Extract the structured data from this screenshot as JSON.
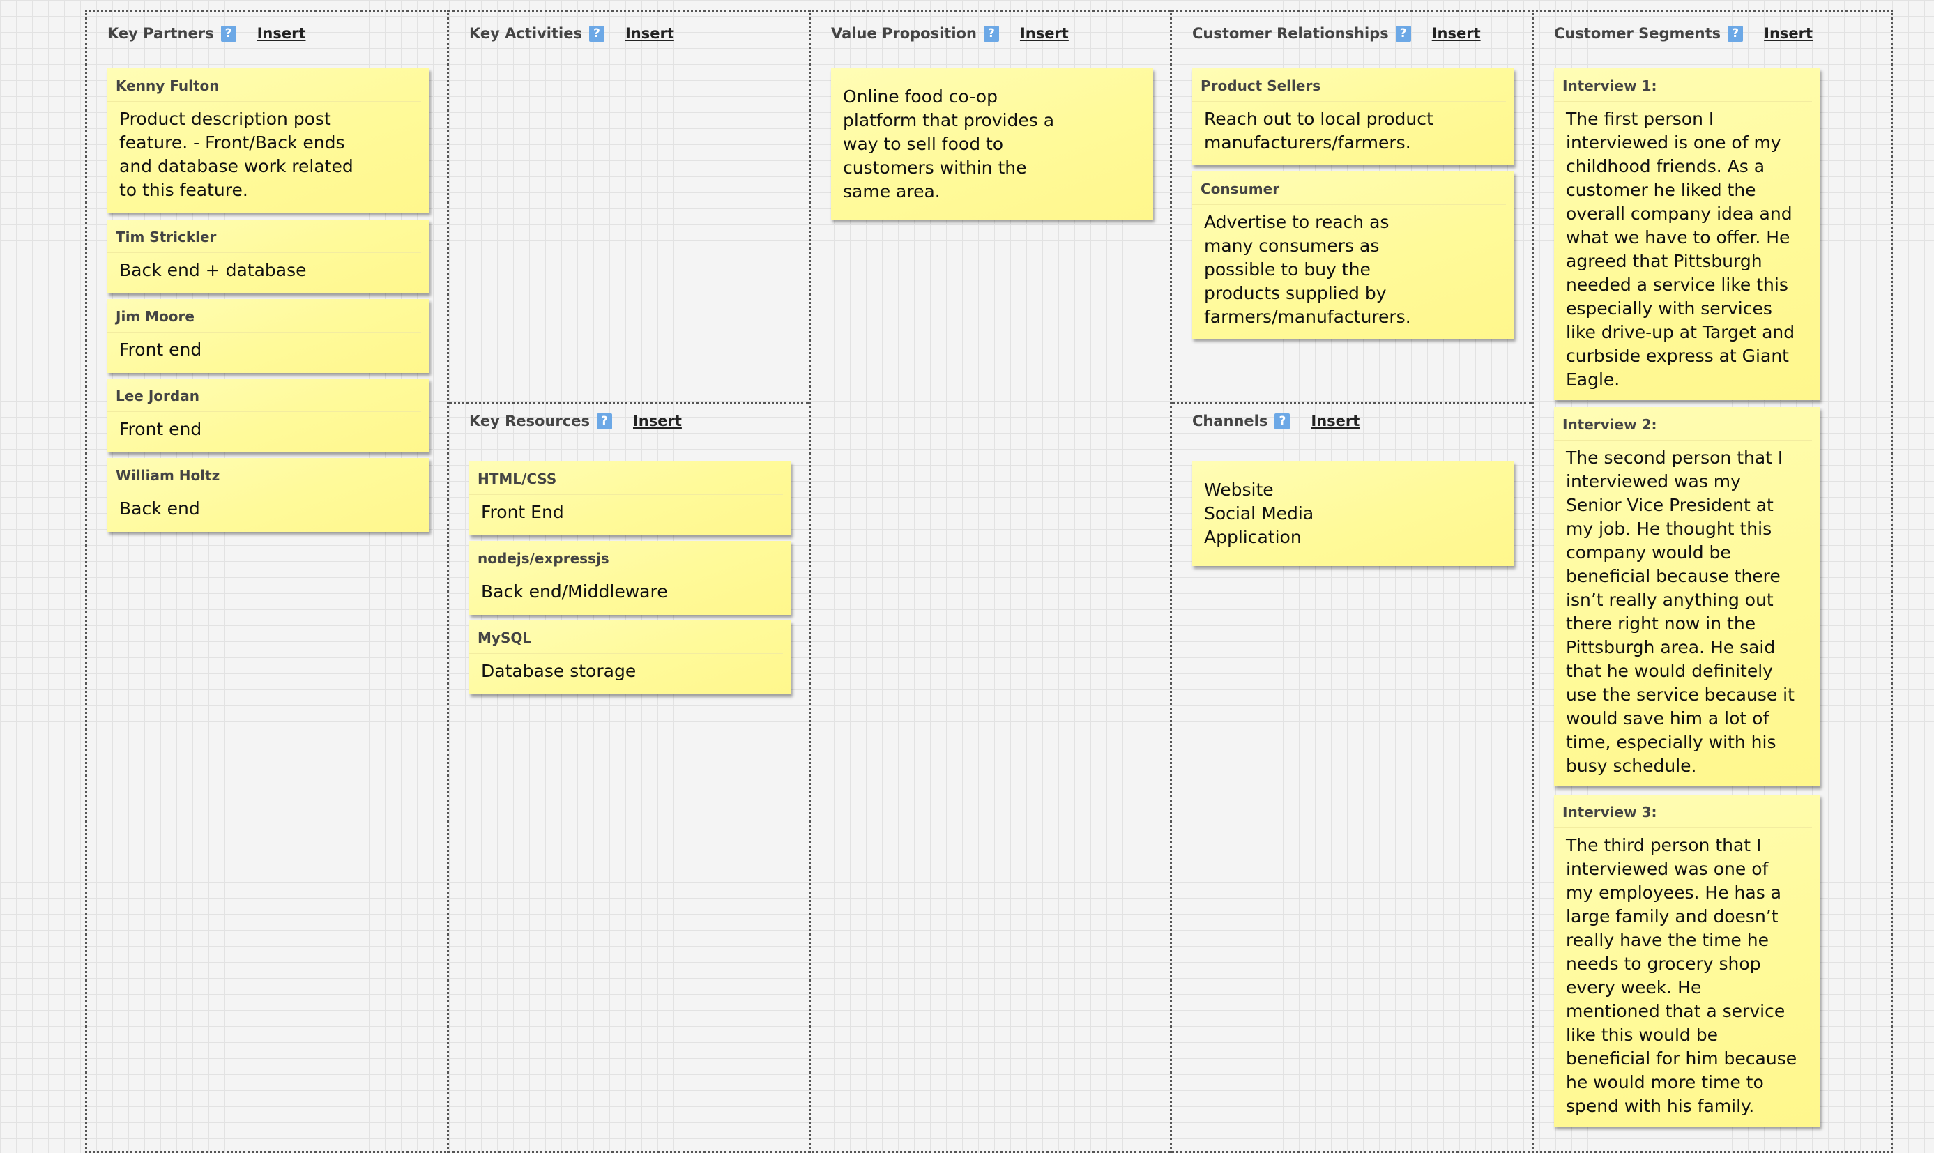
{
  "canvas": {
    "sections": {
      "key_partners": {
        "title": "Key Partners",
        "help": "?",
        "insert": "Insert",
        "notes": [
          {
            "title": "Kenny Fulton",
            "body": "Product description post\nfeature. - Front/Back ends\nand database work related\nto this feature."
          },
          {
            "title": "Tim Strickler",
            "body": "Back end + database"
          },
          {
            "title": "Jim Moore",
            "body": "Front end"
          },
          {
            "title": "Lee Jordan",
            "body": "Front end"
          },
          {
            "title": "William Holtz",
            "body": "Back end"
          }
        ]
      },
      "key_activities": {
        "title": "Key Activities",
        "help": "?",
        "insert": "Insert",
        "notes": []
      },
      "key_resources": {
        "title": "Key Resources",
        "help": "?",
        "insert": "Insert",
        "notes": [
          {
            "title": "HTML/CSS",
            "body": "Front End"
          },
          {
            "title": "nodejs/expressjs",
            "body": "Back end/Middleware"
          },
          {
            "title": "MySQL",
            "body": "Database storage"
          }
        ]
      },
      "value_proposition": {
        "title": "Value Proposition",
        "help": "?",
        "insert": "Insert",
        "notes": [
          {
            "title": "",
            "body": "Online food co-op\nplatform that provides a\nway to sell food to\ncustomers within the\nsame area."
          }
        ]
      },
      "customer_relationships": {
        "title": "Customer Relationships",
        "help": "?",
        "insert": "Insert",
        "notes": [
          {
            "title": "Product Sellers",
            "body": "Reach out to local product\nmanufacturers/farmers."
          },
          {
            "title": "Consumer",
            "body": "Advertise to reach as\nmany consumers as\npossible to buy the\nproducts supplied by\nfarmers/manufacturers."
          }
        ]
      },
      "channels": {
        "title": "Channels",
        "help": "?",
        "insert": "Insert",
        "notes": [
          {
            "title": "",
            "body": "Website\nSocial Media\nApplication"
          }
        ]
      },
      "customer_segments": {
        "title": "Customer Segments",
        "help": "?",
        "insert": "Insert",
        "notes": [
          {
            "title": "Interview 1:",
            "body": "The first person I\ninterviewed is one of my\nchildhood friends. As a\ncustomer he liked the\noverall company idea and\nwhat we have to offer. He\nagreed that Pittsburgh\nneeded a service like this\nespecially with services\nlike drive-up at Target and\ncurbside express at Giant\nEagle."
          },
          {
            "title": "Interview 2:",
            "body": "The second person that I\ninterviewed was my\nSenior Vice President at\nmy job. He thought this\ncompany would be\nbeneficial because there\nisn’t really anything out\nthere right now in the\nPittsburgh area. He said\nthat he would definitely\nuse the service because it\nwould save him a lot of\ntime, especially with his\nbusy schedule."
          },
          {
            "title": "Interview 3:",
            "body": "The third person that I\ninterviewed was one of\nmy employees. He has a\nlarge family and doesn’t\nreally have the time he\nneeds to grocery shop\nevery week. He\nmentioned that a service\nlike this would be\nbeneficial for him because\nhe would more time to\nspend with his family."
          }
        ]
      }
    }
  }
}
